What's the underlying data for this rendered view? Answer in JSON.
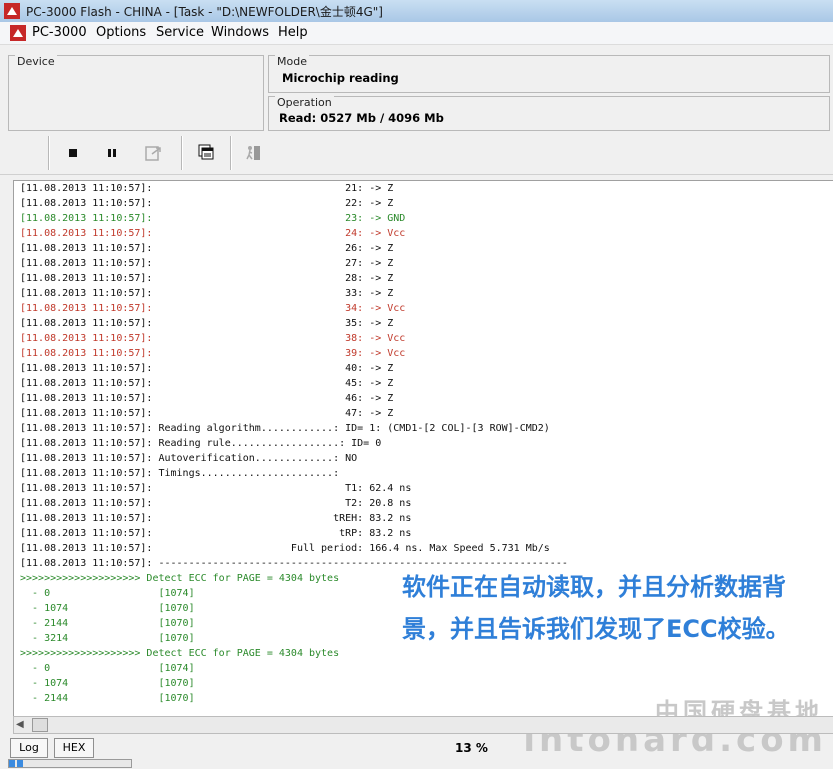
{
  "titlebar": {
    "title": "PC-3000 Flash  - CHINA - [Task - \"D:\\NEWFOLDER\\金士顿4G\"]",
    "icon": "pc3000-app-icon"
  },
  "menubar": {
    "items": [
      "PC-3000",
      "Options",
      "Service",
      "Windows",
      "Help"
    ]
  },
  "device_panel": {
    "legend": "Device"
  },
  "mode_panel": {
    "legend": "Mode",
    "value": "Microchip reading"
  },
  "operation_panel": {
    "legend": "Operation",
    "value": "Read: 0527 Mb / 4096 Mb"
  },
  "toolbar": {
    "buttons": [
      "stop-icon",
      "pause-icon",
      "export-icon",
      "copy-windows-icon",
      "exit-icon"
    ]
  },
  "log": {
    "lines": [
      {
        "text": "[11.08.2013 11:10:57]:                                21: -> Z",
        "color": "#111111"
      },
      {
        "text": "[11.08.2013 11:10:57]:                                22: -> Z",
        "color": "#111111"
      },
      {
        "text": "[11.08.2013 11:10:57]:                                23: -> GND",
        "color": "#2b8a2b"
      },
      {
        "text": "[11.08.2013 11:10:57]:                                24: -> Vcc",
        "color": "#c0392b"
      },
      {
        "text": "[11.08.2013 11:10:57]:                                26: -> Z",
        "color": "#111111"
      },
      {
        "text": "[11.08.2013 11:10:57]:                                27: -> Z",
        "color": "#111111"
      },
      {
        "text": "[11.08.2013 11:10:57]:                                28: -> Z",
        "color": "#111111"
      },
      {
        "text": "[11.08.2013 11:10:57]:                                33: -> Z",
        "color": "#111111"
      },
      {
        "text": "[11.08.2013 11:10:57]:                                34: -> Vcc",
        "color": "#c0392b"
      },
      {
        "text": "[11.08.2013 11:10:57]:                                35: -> Z",
        "color": "#111111"
      },
      {
        "text": "[11.08.2013 11:10:57]:                                38: -> Vcc",
        "color": "#c0392b"
      },
      {
        "text": "[11.08.2013 11:10:57]:                                39: -> Vcc",
        "color": "#c0392b"
      },
      {
        "text": "[11.08.2013 11:10:57]:                                40: -> Z",
        "color": "#111111"
      },
      {
        "text": "[11.08.2013 11:10:57]:                                45: -> Z",
        "color": "#111111"
      },
      {
        "text": "[11.08.2013 11:10:57]:                                46: -> Z",
        "color": "#111111"
      },
      {
        "text": "[11.08.2013 11:10:57]:                                47: -> Z",
        "color": "#111111"
      },
      {
        "text": "[11.08.2013 11:10:57]: Reading algorithm............: ID= 1: (CMD1-[2 COL]-[3 ROW]-CMD2)",
        "color": "#111111"
      },
      {
        "text": "[11.08.2013 11:10:57]: Reading rule..................: ID= 0",
        "color": "#111111"
      },
      {
        "text": "[11.08.2013 11:10:57]: Autoverification.............: NO",
        "color": "#111111"
      },
      {
        "text": "[11.08.2013 11:10:57]: Timings......................:",
        "color": "#111111"
      },
      {
        "text": "[11.08.2013 11:10:57]:                                T1: 62.4 ns",
        "color": "#111111"
      },
      {
        "text": "[11.08.2013 11:10:57]:                                T2: 20.8 ns",
        "color": "#111111"
      },
      {
        "text": "[11.08.2013 11:10:57]:                              tREH: 83.2 ns",
        "color": "#111111"
      },
      {
        "text": "[11.08.2013 11:10:57]:                               tRP: 83.2 ns",
        "color": "#111111"
      },
      {
        "text": "[11.08.2013 11:10:57]:                       Full period: 166.4 ns. Max Speed 5.731 Mb/s",
        "color": "#111111"
      },
      {
        "text": "[11.08.2013 11:10:57]: --------------------------------------------------------------------",
        "color": "#111111"
      },
      {
        "text": ">>>>>>>>>>>>>>>>>>>> Detect ECC for PAGE = 4304 bytes",
        "color": "#2b8a2b"
      },
      {
        "text": "  - 0                  [1074]",
        "color": "#2b8a2b"
      },
      {
        "text": "  - 1074               [1070]",
        "color": "#2b8a2b"
      },
      {
        "text": "  - 2144               [1070]",
        "color": "#2b8a2b"
      },
      {
        "text": "  - 3214               [1070]",
        "color": "#2b8a2b"
      },
      {
        "text": ">>>>>>>>>>>>>>>>>>>> Detect ECC for PAGE = 4304 bytes",
        "color": "#2b8a2b"
      },
      {
        "text": "  - 0                  [1074]",
        "color": "#2b8a2b"
      },
      {
        "text": "  - 1074               [1070]",
        "color": "#2b8a2b"
      },
      {
        "text": "  - 2144               [1070]",
        "color": "#2b8a2b"
      }
    ]
  },
  "annotation": {
    "text": "软件正在自动读取，并且分析数据背景，并且告诉我们发现了ECC校验。",
    "color": "#2f7fd8"
  },
  "watermark": {
    "line1": "中国硬盘基地",
    "line2": "intohard.com"
  },
  "tabs": [
    "Log",
    "HEX"
  ],
  "status": {
    "percent": "13 %",
    "progress": 0.13
  }
}
